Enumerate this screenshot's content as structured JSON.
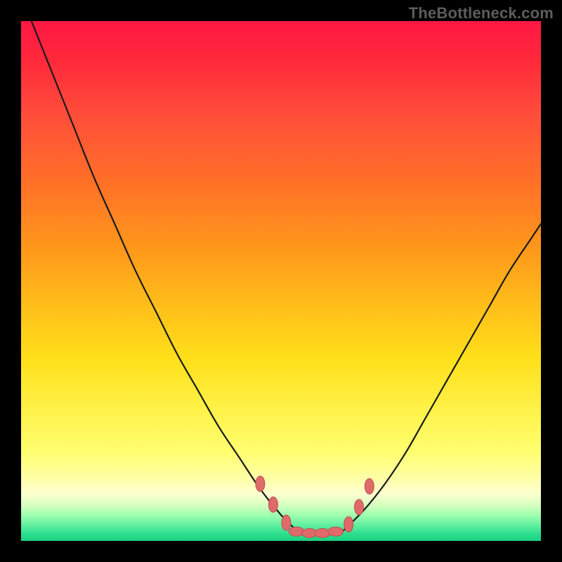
{
  "watermark": "TheBottleneck.com",
  "colors": {
    "frame_bg": "#000000",
    "curve_stroke": "#1a1a1a",
    "marker_fill": "#e06a6a",
    "marker_stroke": "#c04f4f"
  },
  "chart_data": {
    "type": "line",
    "title": "",
    "xlabel": "",
    "ylabel": "",
    "xlim": [
      0,
      100
    ],
    "ylim": [
      0,
      100
    ],
    "grid": false,
    "series": [
      {
        "name": "left-curve",
        "x": [
          2,
          6,
          10,
          14,
          18,
          22,
          26,
          30,
          34,
          38,
          42,
          46,
          50,
          53
        ],
        "y": [
          100,
          90,
          80,
          70,
          61,
          52,
          44,
          36,
          29,
          22,
          16,
          10,
          5,
          2
        ]
      },
      {
        "name": "right-curve",
        "x": [
          62,
          66,
          70,
          74,
          78,
          82,
          86,
          90,
          94,
          98,
          100
        ],
        "y": [
          2,
          6,
          11,
          17,
          24,
          31,
          38,
          45,
          52,
          58,
          61
        ]
      },
      {
        "name": "valley-floor",
        "x": [
          53,
          55,
          57,
          59,
          61,
          62
        ],
        "y": [
          2,
          1.5,
          1.3,
          1.3,
          1.5,
          2
        ]
      }
    ],
    "markers": [
      {
        "x": 46,
        "y": 11,
        "shape": "oval-v"
      },
      {
        "x": 48.5,
        "y": 7,
        "shape": "oval-v"
      },
      {
        "x": 51,
        "y": 3.5,
        "shape": "oval-v"
      },
      {
        "x": 53,
        "y": 1.8,
        "shape": "oval-h"
      },
      {
        "x": 55.5,
        "y": 1.5,
        "shape": "oval-h"
      },
      {
        "x": 58,
        "y": 1.5,
        "shape": "oval-h"
      },
      {
        "x": 60.5,
        "y": 1.8,
        "shape": "oval-h"
      },
      {
        "x": 63,
        "y": 3.2,
        "shape": "oval-v"
      },
      {
        "x": 65,
        "y": 6.5,
        "shape": "oval-v"
      },
      {
        "x": 67,
        "y": 10.5,
        "shape": "oval-v"
      }
    ]
  }
}
